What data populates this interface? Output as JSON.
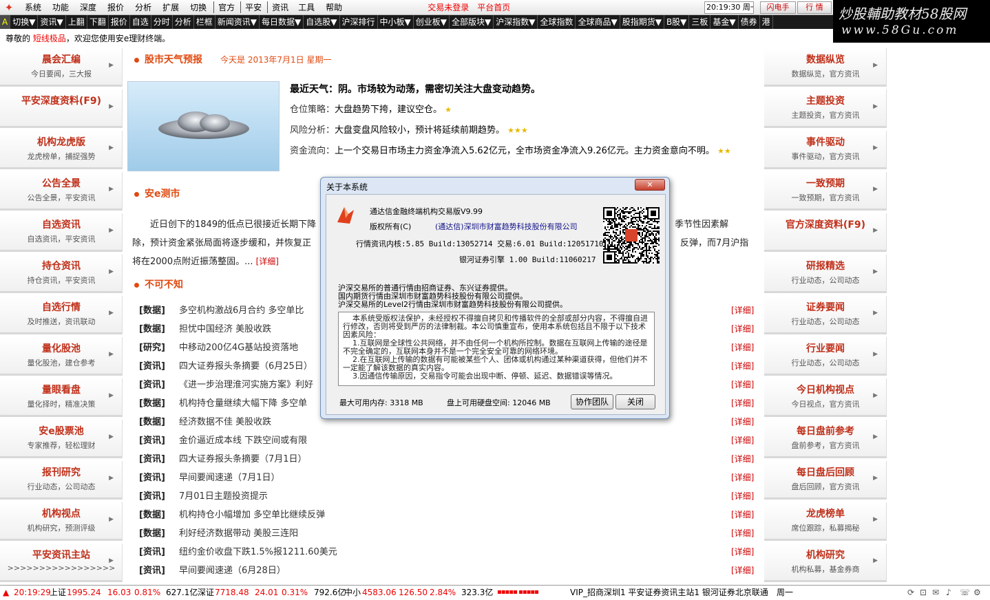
{
  "menubar": {
    "items": [
      "系统",
      "功能",
      "深度",
      "报价",
      "分析",
      "扩展",
      "切换",
      "官方",
      "平安",
      "资讯",
      "工具",
      "帮助"
    ],
    "login_status": "交易未登录",
    "home_link": "平台首页",
    "clock": "20:19:30 周一",
    "flash_btn": "闪电手",
    "quote_btn": "行 情"
  },
  "watermark": {
    "line1": "炒股輔助教材58股网",
    "line2": "www.58Gu.com"
  },
  "toolbar": {
    "items": [
      "A",
      "切换▼",
      "资讯▼",
      "上翻",
      "下翻",
      "报价",
      "自选",
      "分时",
      "分析",
      "栏框",
      "新闻资讯▼",
      "每日数据▼",
      "自选股▼",
      "沪深排行",
      "中小板▼",
      "创业板▼",
      "全部版块▼",
      "沪深指数▼",
      "全球指数",
      "全球商品▼",
      "股指期货▼",
      "B股▼",
      "三板",
      "基金▼",
      "债券",
      "港"
    ]
  },
  "greeting": {
    "prefix": "尊敬的 ",
    "name": "短线极品",
    "suffix": "，欢迎您使用安e理财终端。"
  },
  "left_cards": [
    {
      "title": "晨会汇编",
      "sub": "今日要闻，三大报"
    },
    {
      "title": "平安深度资料(F9)",
      "sub": ""
    },
    {
      "title": "机构龙虎版",
      "sub": "龙虎榜单，捕捉强势"
    },
    {
      "title": "公告全景",
      "sub": "公告全景，平安资讯"
    },
    {
      "title": "自选资讯",
      "sub": "自选资讯，平安资讯"
    },
    {
      "title": "持仓资讯",
      "sub": "持仓资讯，平安资讯"
    },
    {
      "title": "自选行情",
      "sub": "及时推送，资讯联动"
    },
    {
      "title": "量化股池",
      "sub": "量化股池，建仓参考"
    },
    {
      "title": "量眼看盘",
      "sub": "量化择时，精准决策"
    },
    {
      "title": "安e股票池",
      "sub": "专家推荐，轻松理财"
    },
    {
      "title": "报刊研究",
      "sub": "行业动态，公司动态"
    },
    {
      "title": "机构视点",
      "sub": "机构研究，预测评级"
    },
    {
      "title": "平安资讯主站",
      "sub": ">>>>>>>>>>>>>>>>>"
    }
  ],
  "right_cards": [
    {
      "title": "数据纵览",
      "sub": "数据纵览，官方资讯"
    },
    {
      "title": "主题投资",
      "sub": "主题投资，官方资讯"
    },
    {
      "title": "事件驱动",
      "sub": "事件驱动，官方资讯"
    },
    {
      "title": "一致预期",
      "sub": "一致预期，官方资讯"
    },
    {
      "title": "官方深度资料(F9)",
      "sub": ""
    },
    {
      "title": "研报精选",
      "sub": "行业动态，公司动态"
    },
    {
      "title": "证券要闻",
      "sub": "行业动态，公司动态"
    },
    {
      "title": "行业要闻",
      "sub": "行业动态，公司动态"
    },
    {
      "title": "今日机构视点",
      "sub": "今日视点，官方资讯"
    },
    {
      "title": "每日盘前参考",
      "sub": "盘前参考，官方资讯"
    },
    {
      "title": "每日盘后回顾",
      "sub": "盘后回顾，官方资讯"
    },
    {
      "title": "龙虎榜单",
      "sub": "席位跟踪，私募揭秘"
    },
    {
      "title": "机构研究",
      "sub": "机构私募，基金券商"
    }
  ],
  "weather": {
    "section_title": "股市天气预报",
    "date": "今天是 2013年7月1日 星期一",
    "headline": "最近天气：阴。市场较为动荡，需密切关注大盘变动趋势。",
    "rows": [
      {
        "label": "仓位策略：",
        "text": "大盘趋势下挎，建议空仓。",
        "stars": "★"
      },
      {
        "label": "风险分析：",
        "text": "大盘变盘风险较小，预计将延续前期趋势。",
        "stars": "★★★"
      },
      {
        "label": "资金流向：",
        "text": "上一个交易日市场主力资金净流入5.62亿元，全市场资金净流入9.26亿元。主力资金意向不明。",
        "stars": "★★"
      }
    ]
  },
  "ece": {
    "section_title": "安e测市",
    "line1a": "近日创下的1849的低点已很接近长期下降",
    "line1b": "，季节性因素解",
    "line2a": "除，预计资金紧张局面将逐步缓和，并恢复正",
    "line2b": "反弹，而7月沪指",
    "line3": "将在2000点附近振荡整固。...",
    "detail": "[详细]"
  },
  "news": {
    "section_title": "不可不知",
    "detail_label": "[详细]",
    "items": [
      {
        "tag": "[数据]",
        "text": "多空机构激战6月合约 多空单比"
      },
      {
        "tag": "[数据]",
        "text": "担忧中国经济 美股收跌"
      },
      {
        "tag": "[研究]",
        "text": "中移动200亿4G基站投资落地"
      },
      {
        "tag": "[资讯]",
        "text": "四大证券报头条摘要（6月25日）"
      },
      {
        "tag": "[资讯]",
        "text": "《进一步治理淮河实施方案》利好"
      },
      {
        "tag": "[数据]",
        "text": "机构持仓量继续大幅下降 多空单"
      },
      {
        "tag": "[数据]",
        "text": "经济数据不佳 美股收跌"
      },
      {
        "tag": "[资讯]",
        "text": "金价逼近成本线 下跌空间或有限"
      },
      {
        "tag": "[资讯]",
        "text": "四大证券报头条摘要（7月1日）"
      },
      {
        "tag": "[资讯]",
        "text": "早间要闻速递（7月1日）"
      },
      {
        "tag": "[资讯]",
        "text": "7月01日主题投资提示"
      },
      {
        "tag": "[数据]",
        "text": "机构持仓小幅增加 多空单比继续反弹"
      },
      {
        "tag": "[数据]",
        "text": "利好经济数据带动 美股三连阳"
      },
      {
        "tag": "[资讯]",
        "text": "纽约金价收盘下跌1.5%报1211.60美元"
      },
      {
        "tag": "[资讯]",
        "text": "早间要闻速递（6月28日）"
      }
    ]
  },
  "dialog": {
    "title": "关于本系统",
    "close": "✕",
    "product": "通达信金融终端机构交易版V9.99",
    "copyright_label": "版权所有(C)",
    "company": "(通达信)深圳市财富趋势科技股份有限公司",
    "version1": "行情资讯内核:5.85 Build:13052714 交易:6.01 Build:12051710",
    "version2": "银河证券引擎 1.00 Build:11060217",
    "provider1": "沪深交易所的普通行情由招商证券、东兴证券提供。",
    "provider2": "国内期货行情由深圳市财富趋势科技股份有限公司提供。",
    "provider3": "沪深交易所的Level2行情由深圳市财富趋势科技股份有限公司提供。",
    "notice": "本系统受版权法保护，未经授权不得擅自拷贝和传播软件的全部或部分内容，不得擅自进行修改，否则将受到严厉的法律制裁。本公司慎重宣布，使用本系统包括且不限于以下技术因素风险：\n1.互联网是全球性公共网络，并不由任何一个机构所控制。数据在互联网上传输的途径是不完全确定的，互联网本身并不是一个完全安全可靠的网络环境。\n2.在互联网上传输的数据有可能被某些个人、团体或机构通过某种渠道获得，但他们并不一定能了解该数据的真实内容。\n3.因通信传输原因，交易指令可能会出现中断、停顿、延迟、数据错误等情况。",
    "memory": "最大可用内存: 3318 MB",
    "disk": "盘上可用硬盘空间: 12046 MB",
    "team_btn": "协作团队",
    "close_btn": "关闭"
  },
  "statusbar": {
    "time": "20:19:29",
    "sh": "上证",
    "sh_val": "1995.24",
    "sh_chg": "16.03",
    "sh_pct": "0.81%",
    "sh_amt": "627.1亿",
    "sz": "深证",
    "sz_val": "7718.48",
    "sz_chg": "24.01",
    "sz_pct": "0.31%",
    "sz_amt": "792.6亿",
    "zx": "中小",
    "zx_val": "4583.06",
    "zx_chg": "126.50",
    "zx_pct": "2.84%",
    "zx_amt": "323.3亿",
    "bars": "▪▪▪▪▪ ▪▪▪▪▪",
    "sites": "VIP_招商深圳1 平安证券资讯主站1 银河证券北京联通",
    "weekday": "周一"
  },
  "colors": {
    "accent": "#e04a10",
    "title_red": "#c0301a",
    "link_red": "#cc0000"
  }
}
